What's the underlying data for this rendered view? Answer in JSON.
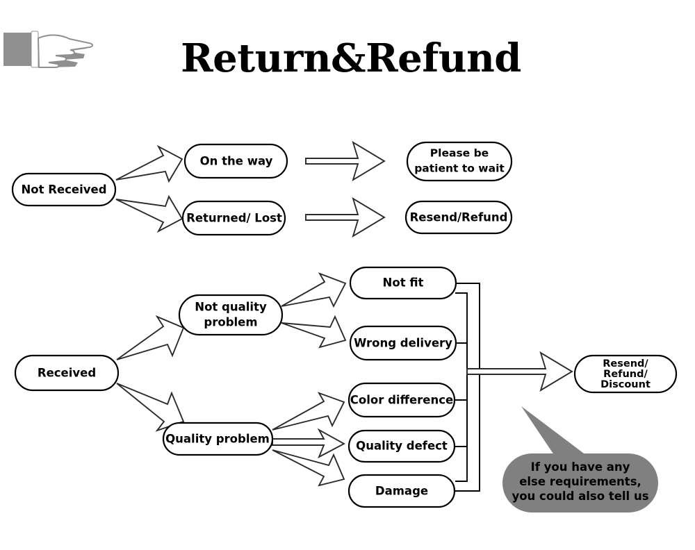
{
  "page": {
    "title": "Return&Refund",
    "background_color": "#ffffff",
    "accent_gray": "#808080"
  },
  "header": {
    "title": "Return&Refund",
    "pointer_icon": "pointing-hand-icon"
  },
  "flow_not_received": {
    "source": {
      "id": "not-received",
      "label": "Not Received"
    },
    "branches": [
      {
        "id": "on-the-way",
        "label": "On the way",
        "outcome": {
          "id": "please-be-patient",
          "label": "Please be\npatient to wait",
          "line1": "Please be",
          "line2": "patient to wait"
        }
      },
      {
        "id": "returned-lost",
        "label": "Returned/ Lost",
        "outcome": {
          "id": "resend-refund",
          "label": "Resend/Refund"
        }
      }
    ]
  },
  "flow_received": {
    "source": {
      "id": "received",
      "label": "Received"
    },
    "categories": [
      {
        "id": "not-quality-problem",
        "label": "Not quality problem",
        "line1": "Not quality",
        "line2": "problem",
        "reasons": [
          {
            "id": "not-fit",
            "label": "Not fit"
          },
          {
            "id": "wrong-delivery",
            "label": "Wrong delivery"
          }
        ]
      },
      {
        "id": "quality-problem",
        "label": "Quality problem",
        "reasons": [
          {
            "id": "color-difference",
            "label": "Color difference"
          },
          {
            "id": "quality-defect",
            "label": "Quality defect"
          },
          {
            "id": "damage",
            "label": "Damage"
          }
        ]
      }
    ],
    "outcome": {
      "id": "resend-refund-discount",
      "label": "Resend/ Refund/ Discount",
      "line1": "Resend/",
      "line2": "Refund/",
      "line3": "Discount"
    }
  },
  "callout": {
    "id": "extra-requirements-callout",
    "line1": "If you have any",
    "line2": "else requirements,",
    "line3": "you could also tell us",
    "fill_color": "#808080"
  }
}
